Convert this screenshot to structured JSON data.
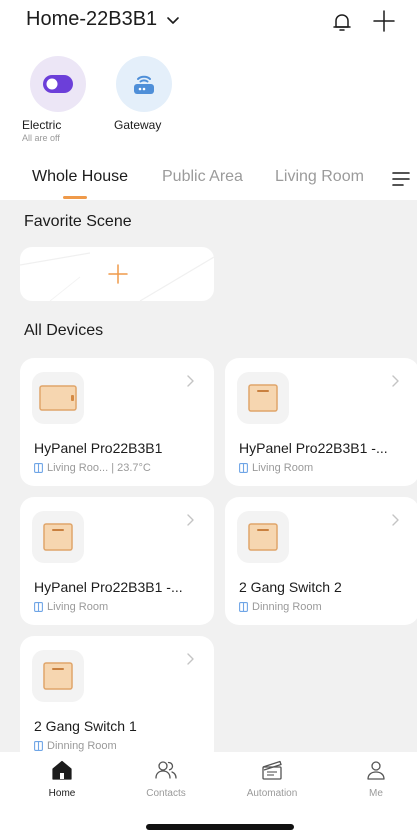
{
  "header": {
    "home_name": "Home-22B3B1",
    "icons": [
      "chevron-down-icon",
      "bell-icon",
      "plus-icon"
    ]
  },
  "quick_access": [
    {
      "label": "Electric",
      "sub": "All are off",
      "icon": "toggle-icon",
      "bg": "#ece6f6",
      "accent": "#6c3fd9"
    },
    {
      "label": "Gateway",
      "sub": "",
      "icon": "router-icon",
      "bg": "#e4effa",
      "accent": "#4f8fd8"
    }
  ],
  "tabs": [
    {
      "label": "Whole House",
      "active": true
    },
    {
      "label": "Public Area",
      "active": false
    },
    {
      "label": "Living Room",
      "active": false
    }
  ],
  "sections": {
    "favorite_scene": "Favorite Scene",
    "all_devices": "All Devices"
  },
  "devices": [
    {
      "name": "HyPanel Pro22B3B1",
      "room": "Living Roo... | 23.7°C",
      "icon": "panel-wide-icon"
    },
    {
      "name": "HyPanel Pro22B3B1 -...",
      "room": "Living Room",
      "icon": "switch-icon"
    },
    {
      "name": "HyPanel Pro22B3B1 -...",
      "room": "Living Room",
      "icon": "switch-icon"
    },
    {
      "name": "2 Gang Switch 2",
      "room": "Dinning Room",
      "icon": "switch-icon"
    },
    {
      "name": "2 Gang Switch 1",
      "room": "Dinning Room",
      "icon": "switch-icon"
    }
  ],
  "bottom_nav": [
    {
      "label": "Home",
      "icon": "home-icon",
      "active": true
    },
    {
      "label": "Contacts",
      "icon": "contacts-icon",
      "active": false
    },
    {
      "label": "Automation",
      "icon": "automation-icon",
      "active": false
    },
    {
      "label": "Me",
      "icon": "person-icon",
      "active": false
    }
  ],
  "colors": {
    "accent": "#ef9a4a",
    "background": "#f1f1f1",
    "card": "#ffffff"
  }
}
